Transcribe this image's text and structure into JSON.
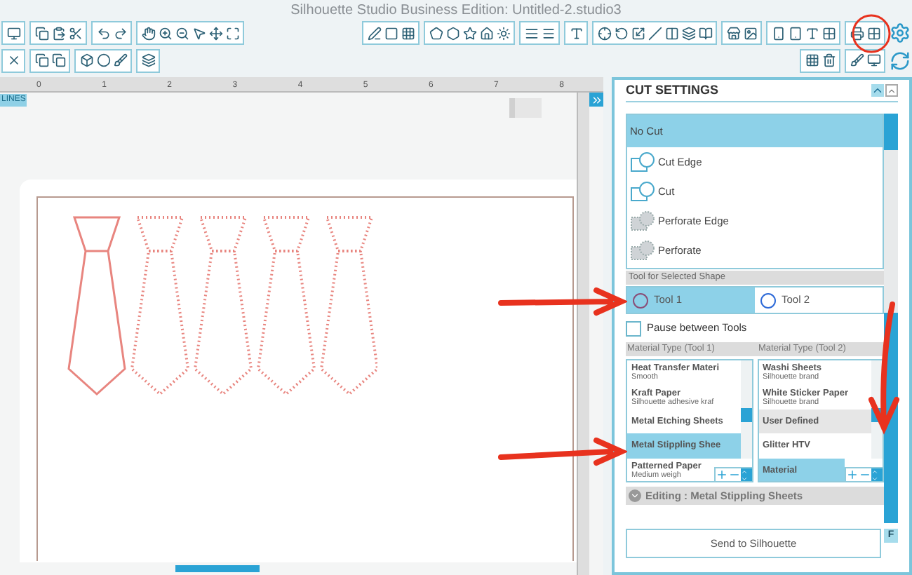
{
  "window": {
    "title": "Silhouette Studio Business Edition: Untitled-2.studio3"
  },
  "canvas": {
    "badge": "LINES",
    "ruler_labels": [
      "0",
      "1",
      "2",
      "3",
      "4",
      "5",
      "6",
      "7",
      "8"
    ]
  },
  "cut_settings": {
    "title": "CUT SETTINGS",
    "cut_modes": [
      {
        "label": "No Cut",
        "kind": "none",
        "selected": true
      },
      {
        "label": "Cut Edge",
        "kind": "edge",
        "selected": false
      },
      {
        "label": "Cut",
        "kind": "cut",
        "selected": false
      },
      {
        "label": "Perforate Edge",
        "kind": "perf-edge",
        "selected": false
      },
      {
        "label": "Perforate",
        "kind": "perf",
        "selected": false
      }
    ],
    "tool_section": "Tool for Selected Shape",
    "tools": [
      {
        "label": "Tool 1",
        "selected": true,
        "color": "#8a4f78"
      },
      {
        "label": "Tool 2",
        "selected": false,
        "color": "#2f6bd8"
      }
    ],
    "pause_between_tools": {
      "label": "Pause between Tools",
      "checked": false
    },
    "material_lists": [
      {
        "heading": "Material Type (Tool 1)",
        "items": [
          {
            "name": "Heat Transfer Materi",
            "detail": "Smooth",
            "kind": "item",
            "selected": false
          },
          {
            "name": "Kraft Paper",
            "detail": "Silhouette adhesive kraf",
            "kind": "item",
            "selected": false
          },
          {
            "name": "Metal Etching Sheets",
            "kind": "item",
            "selected": false
          },
          {
            "name": "Metal Stippling Shee",
            "kind": "item",
            "selected": true
          },
          {
            "name": "Patterned Paper",
            "detail": "Medium weigh",
            "kind": "item",
            "selected": false
          }
        ]
      },
      {
        "heading": "Material Type (Tool 2)",
        "items": [
          {
            "name": "Washi Sheets",
            "detail": "Silhouette brand",
            "kind": "item",
            "selected": false
          },
          {
            "name": "White Sticker Paper",
            "detail": "Silhouette brand",
            "kind": "item",
            "selected": false
          },
          {
            "name": "User Defined",
            "kind": "group",
            "selected": false
          },
          {
            "name": "Glitter HTV",
            "kind": "item",
            "selected": false
          },
          {
            "name": "Material",
            "kind": "item",
            "selected": true
          }
        ]
      }
    ],
    "editing": "Editing : Metal Stippling Sheets",
    "send_button": "Send to Silhouette",
    "side_button": "F"
  }
}
